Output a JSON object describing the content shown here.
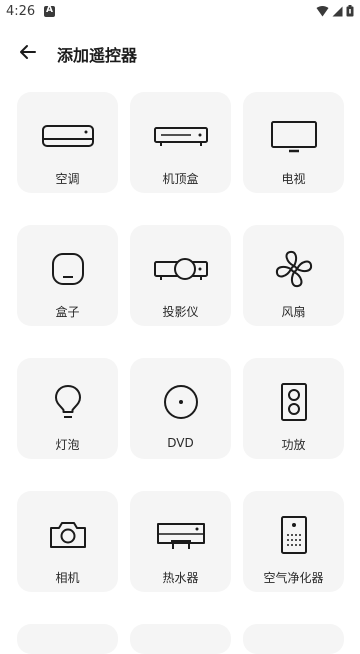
{
  "status_bar": {
    "time": "4:26",
    "notification_letter": "A"
  },
  "header": {
    "title": "添加遥控器"
  },
  "devices": [
    {
      "label": "空调",
      "icon": "air-conditioner-icon"
    },
    {
      "label": "机顶盒",
      "icon": "set-top-box-icon"
    },
    {
      "label": "电视",
      "icon": "tv-icon"
    },
    {
      "label": "盒子",
      "icon": "tv-box-icon"
    },
    {
      "label": "投影仪",
      "icon": "projector-icon"
    },
    {
      "label": "风扇",
      "icon": "fan-icon"
    },
    {
      "label": "灯泡",
      "icon": "bulb-icon"
    },
    {
      "label": "DVD",
      "icon": "dvd-icon"
    },
    {
      "label": "功放",
      "icon": "speaker-icon"
    },
    {
      "label": "相机",
      "icon": "camera-icon"
    },
    {
      "label": "热水器",
      "icon": "water-heater-icon"
    },
    {
      "label": "空气净化器",
      "icon": "air-purifier-icon"
    }
  ]
}
